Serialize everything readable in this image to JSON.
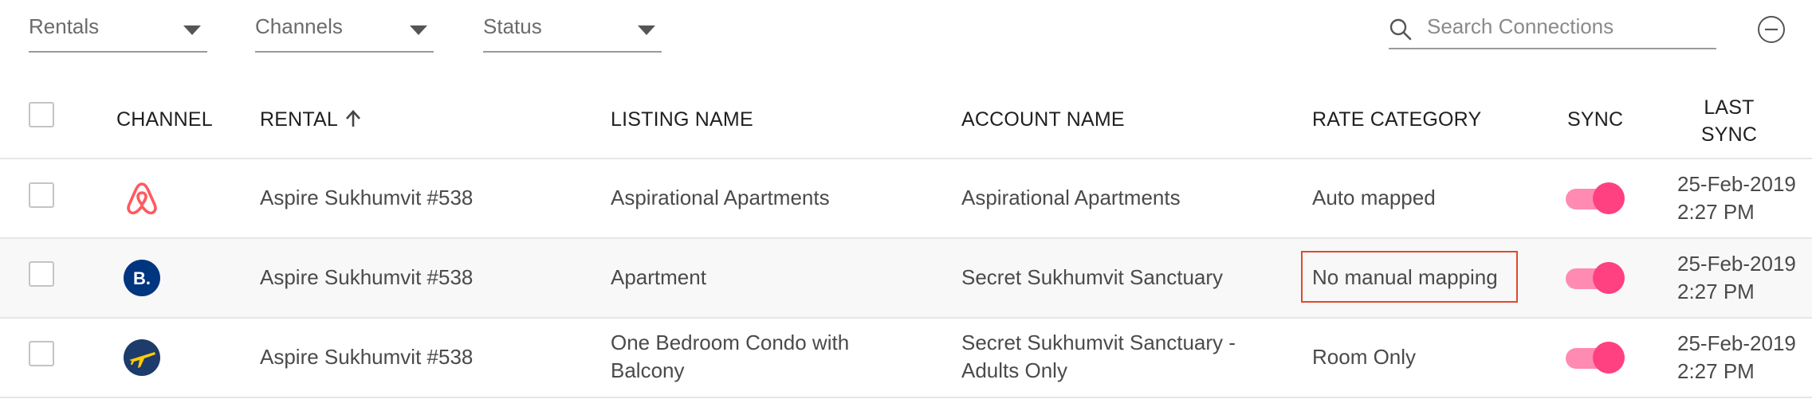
{
  "filters": {
    "rentals": "Rentals",
    "channels": "Channels",
    "status": "Status"
  },
  "search": {
    "placeholder": "Search Connections"
  },
  "columns": {
    "channel": "CHANNEL",
    "rental": "RENTAL",
    "listing_name": "LISTING NAME",
    "account_name": "ACCOUNT NAME",
    "rate_category": "RATE CATEGORY",
    "sync": "SYNC",
    "last_sync_1": "LAST",
    "last_sync_2": "SYNC"
  },
  "rows": [
    {
      "channel_icon": "airbnb-icon",
      "rental": "Aspire Sukhumvit #538",
      "listing_1": "Aspirational Apartments",
      "listing_2": "",
      "account_1": "Aspirational Apartments",
      "account_2": "",
      "rate_category": "Auto mapped",
      "sync_on": true,
      "last_sync_date": "25-Feb-2019",
      "last_sync_time": "2:27 PM"
    },
    {
      "channel_icon": "booking-com-icon",
      "channel_icon_text": "B.",
      "rental": "Aspire Sukhumvit #538",
      "listing_1": "Apartment",
      "listing_2": "",
      "account_1": "Secret Sukhumvit Sanctuary",
      "account_2": "",
      "rate_category": "No manual mapping",
      "sync_on": true,
      "last_sync_date": "25-Feb-2019",
      "last_sync_time": "2:27 PM"
    },
    {
      "channel_icon": "expedia-icon",
      "rental": "Aspire Sukhumvit #538",
      "listing_1": "One Bedroom Condo with",
      "listing_2": "Balcony",
      "account_1": "Secret Sukhumvit Sanctuary -",
      "account_2": "Adults Only",
      "rate_category": "Room Only",
      "sync_on": true,
      "last_sync_date": "25-Feb-2019",
      "last_sync_time": "2:27 PM"
    }
  ],
  "colors": {
    "toggle_on": "#ff4081",
    "toggle_track": "#ff8ab2",
    "airbnb": "#ff5a5f",
    "booking": "#003580",
    "expedia": "#1d3b6b",
    "highlight": "#e0492b"
  }
}
